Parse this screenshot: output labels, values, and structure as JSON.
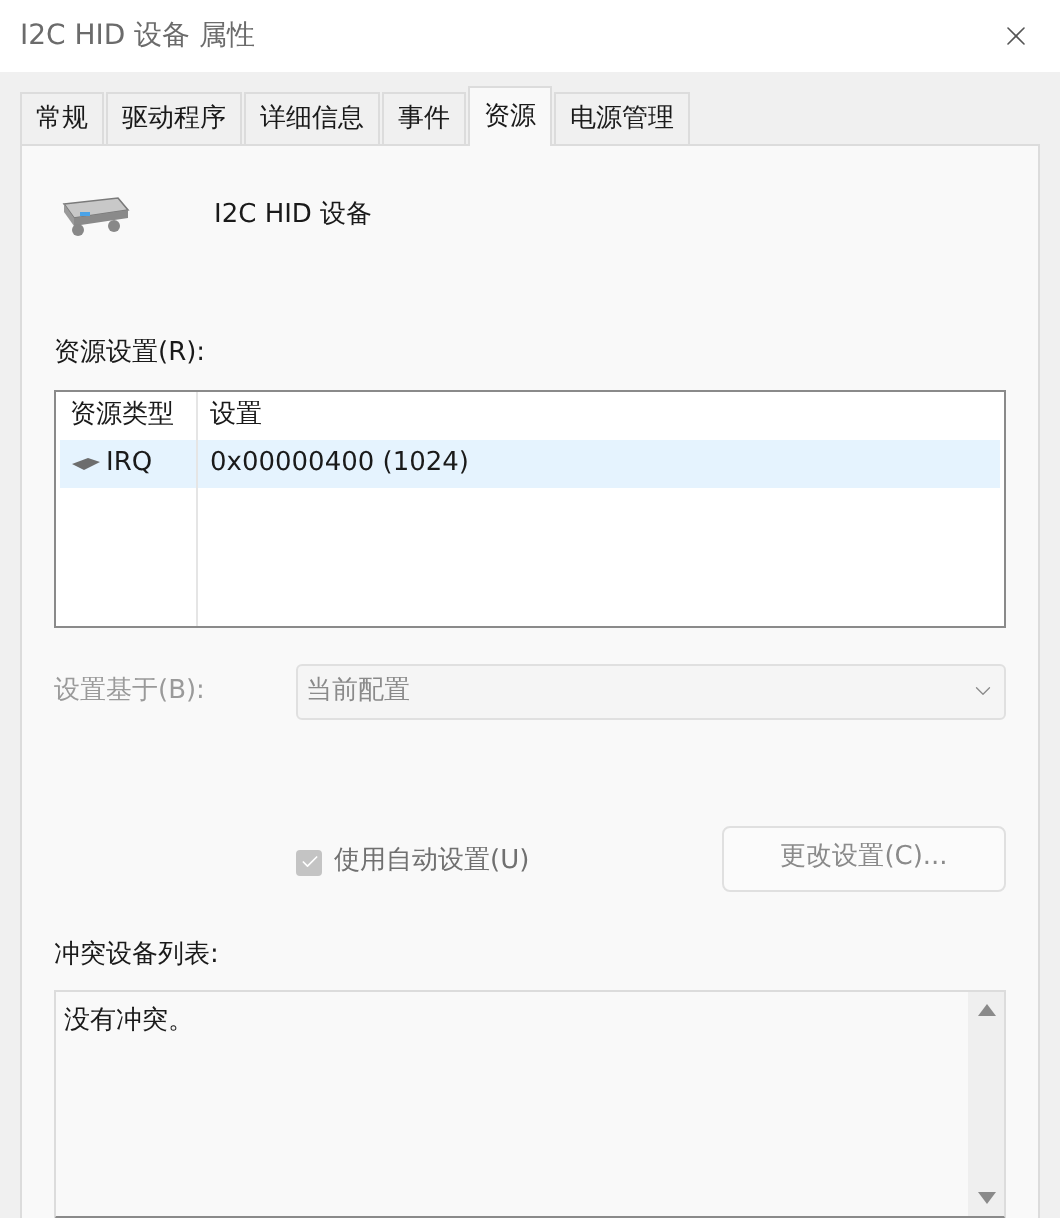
{
  "window": {
    "title": "I2C HID 设备 属性"
  },
  "tabs": [
    {
      "label": "常规",
      "selected": false
    },
    {
      "label": "驱动程序",
      "selected": false
    },
    {
      "label": "详细信息",
      "selected": false
    },
    {
      "label": "事件",
      "selected": false
    },
    {
      "label": "资源",
      "selected": true
    },
    {
      "label": "电源管理",
      "selected": false
    }
  ],
  "device": {
    "name": "I2C HID 设备"
  },
  "resource_settings": {
    "label": "资源设置(R):",
    "columns": [
      "资源类型",
      "设置"
    ],
    "rows": [
      {
        "type": "IRQ",
        "setting": "0x00000400 (1024)",
        "selected": true
      }
    ]
  },
  "setting_based_on": {
    "label": "设置基于(B):",
    "value": "当前配置",
    "disabled": true
  },
  "auto_settings": {
    "label": "使用自动设置(U)",
    "checked": true,
    "disabled": true
  },
  "change_button": {
    "label": "更改设置(C)...",
    "disabled": true
  },
  "conflicts": {
    "label": "冲突设备列表:",
    "text": "没有冲突。"
  }
}
